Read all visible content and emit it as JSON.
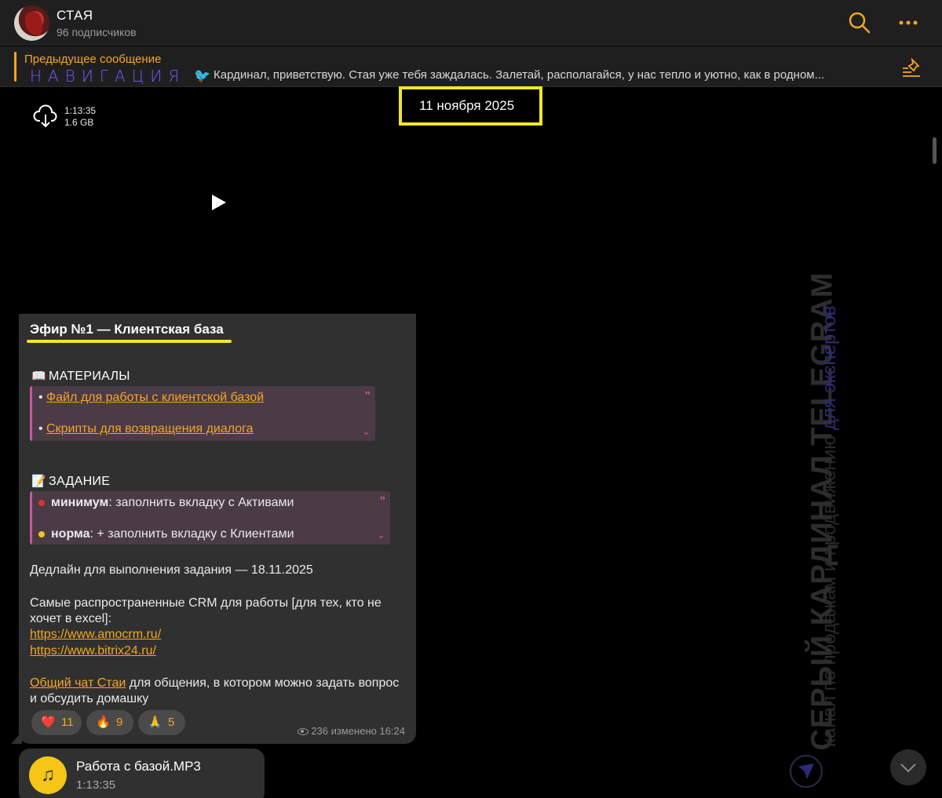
{
  "header": {
    "title": "СТАЯ",
    "subscribers": "96 подписчиков"
  },
  "pinned": {
    "label": "Предыдущее сообщение",
    "nav": "НАВИГАЦИЯ",
    "bird": "🐦",
    "text": "Кардинал, приветствую.  Стая уже тебя заждалась.  Залетай, располагайся, у нас тепло и уютно, как в родном..."
  },
  "date_chip": "11 ноября 2025",
  "message": {
    "video": {
      "duration": "1:13:35",
      "size": "1.6 GB"
    },
    "title": "Эфир №1 — Клиентская база",
    "materials": {
      "emoji": "📖",
      "heading": "МАТЕРИАЛЫ",
      "items": [
        "Файл для работы с клиентской базой ",
        "Скрипты для возвращения диалога"
      ]
    },
    "task": {
      "emoji": "📝",
      "heading": "ЗАДАНИЕ",
      "items": [
        {
          "bold": "минимум",
          "rest": ": заполнить вкладку с Активами",
          "color": "#e03131"
        },
        {
          "bold": "норма",
          "rest": ": + заполнить вкладку с Клиентами",
          "color": "#f5c518"
        }
      ]
    },
    "deadline": "Дедлайн для выполнения задания — 18.11.2025",
    "crm_text": "Самые распространенные CRM для работы [для тех, кто не хочет в excel]:",
    "links": [
      "https://www.amocrm.ru/",
      "https://www.bitrix24.ru/"
    ],
    "chat_link": "Общий чат Стаи",
    "chat_text": " для общения, в котором можно задать вопрос и обсудить домашку",
    "reactions": [
      {
        "emoji": "❤️",
        "count": "11"
      },
      {
        "emoji": "🔥",
        "count": "9"
      },
      {
        "emoji": "🙏",
        "count": "5"
      }
    ],
    "views": "236",
    "edited": "изменено 16:24"
  },
  "audio": {
    "icon": "music-note-icon",
    "name": "Работа с базой.MP3",
    "duration": "1:13:35"
  },
  "watermark": {
    "line1": "СЕРЫЙ КАРДИНАЛ TELEGRAM",
    "line2": "канал по продажам и продвижению ",
    "line2_accent": "для экспертов"
  },
  "colors": {
    "accent": "#f5a524",
    "highlight": "#f2e628",
    "quote_border": "#c45a9b",
    "nav": "#6d5cff"
  }
}
